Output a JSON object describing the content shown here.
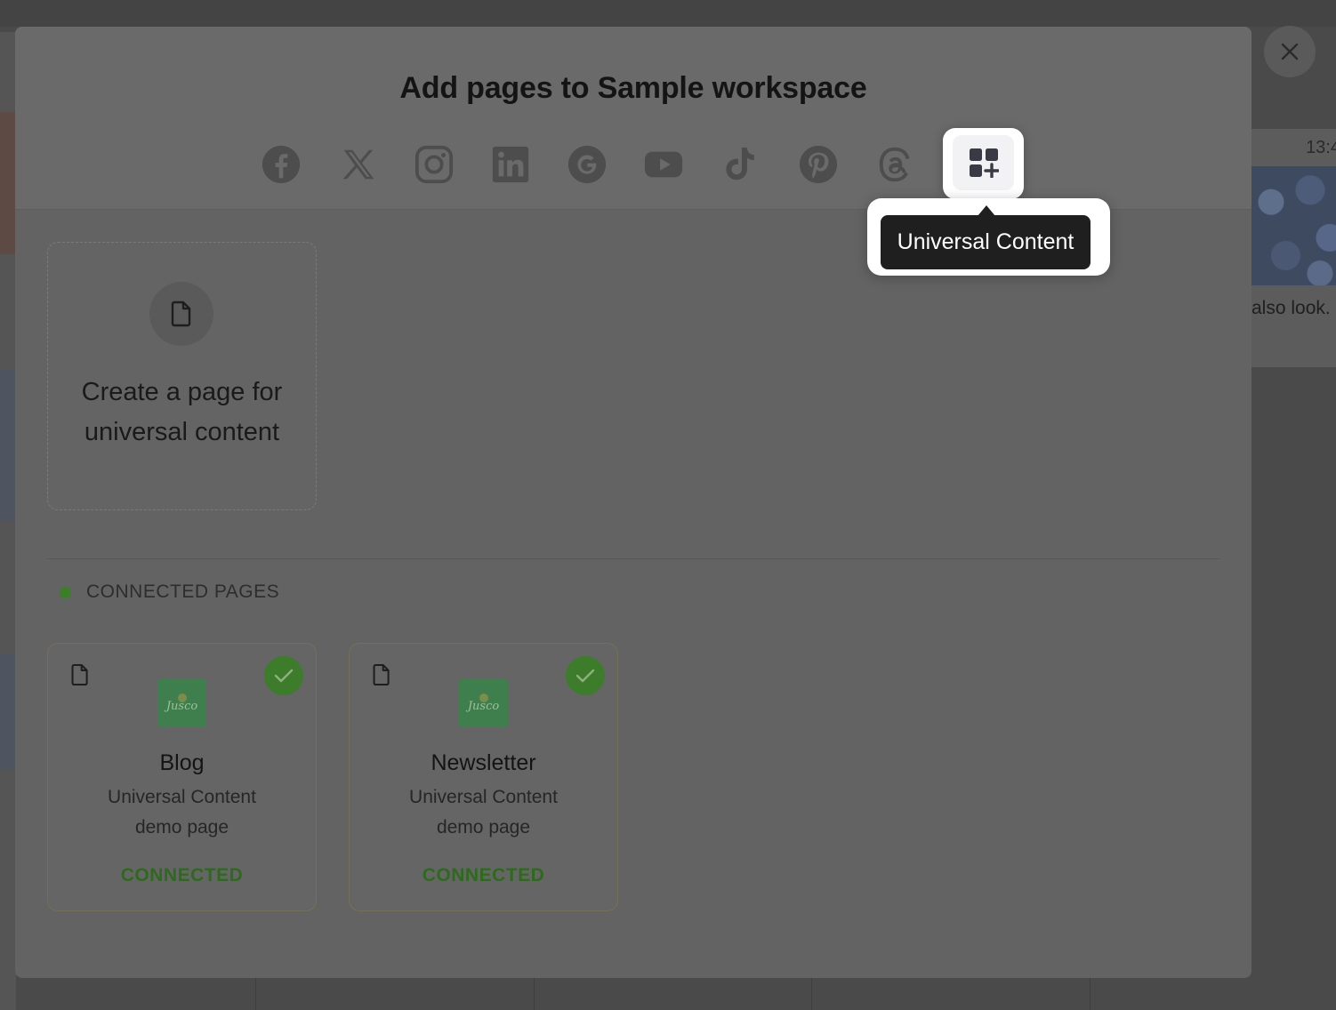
{
  "modal": {
    "title": "Add pages to Sample workspace",
    "platforms": [
      {
        "name": "Facebook",
        "icon": "facebook-icon"
      },
      {
        "name": "X",
        "icon": "x-icon"
      },
      {
        "name": "Instagram",
        "icon": "instagram-icon"
      },
      {
        "name": "LinkedIn",
        "icon": "linkedin-icon"
      },
      {
        "name": "Google",
        "icon": "google-icon"
      },
      {
        "name": "YouTube",
        "icon": "youtube-icon"
      },
      {
        "name": "TikTok",
        "icon": "tiktok-icon"
      },
      {
        "name": "Pinterest",
        "icon": "pinterest-icon"
      },
      {
        "name": "Threads",
        "icon": "threads-icon"
      },
      {
        "name": "Universal Content",
        "icon": "universal-content-icon",
        "active": true
      }
    ],
    "tooltip": "Universal Content",
    "create_card": {
      "line1": "Create a page for",
      "line2": "universal content",
      "icon": "document-icon"
    },
    "connected_section_label": "CONNECTED PAGES",
    "connected_pages": [
      {
        "name": "Blog",
        "subtitle_line1": "Universal Content",
        "subtitle_line2": "demo page",
        "status": "CONNECTED",
        "thumbnail_text": "Jusco"
      },
      {
        "name": "Newsletter",
        "subtitle_line1": "Universal Content",
        "subtitle_line2": "demo page",
        "status": "CONNECTED",
        "thumbnail_text": "Jusco"
      }
    ]
  },
  "background": {
    "card_time": "13:4",
    "card_text": "also look."
  },
  "colors": {
    "connected_green": "#3c7c2a",
    "tooltip_bg": "#1f1f1f",
    "overlay_modal": "#636363"
  }
}
